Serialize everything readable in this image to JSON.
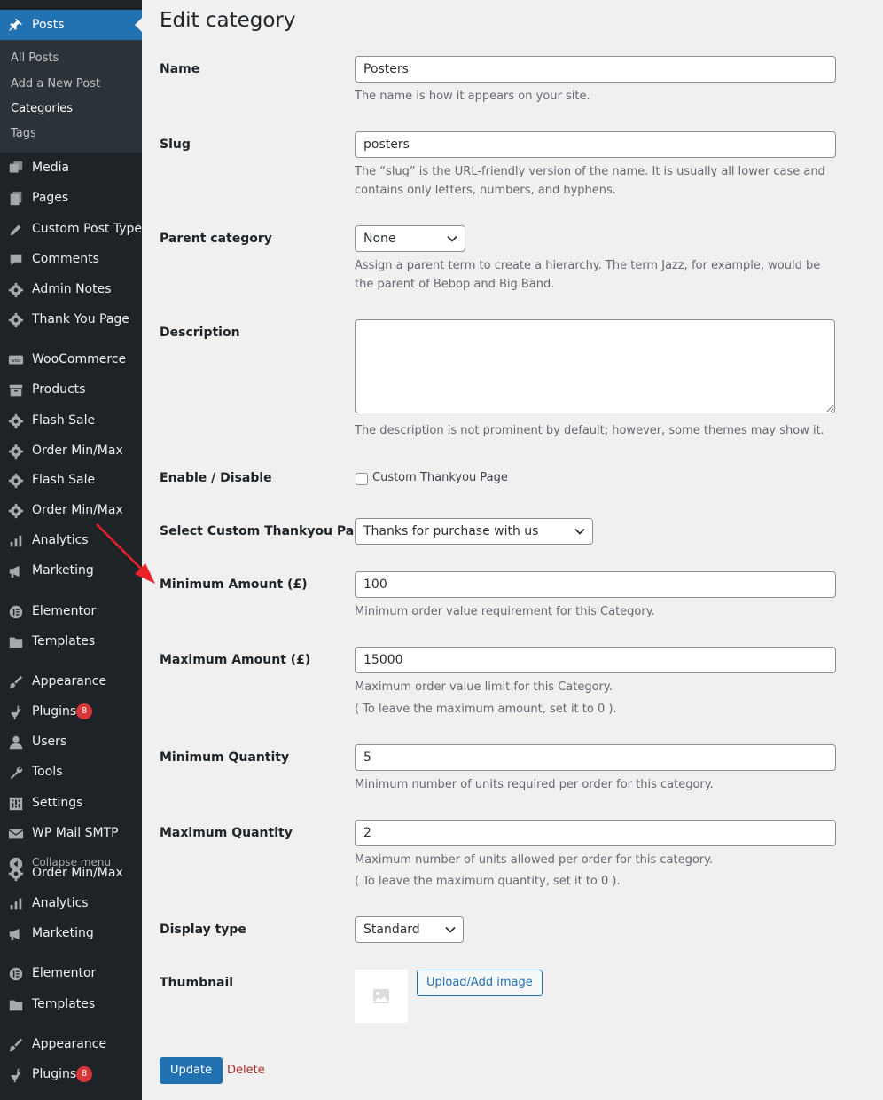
{
  "sidebar": {
    "current": {
      "label": "Posts",
      "icon": "pushpin-icon"
    },
    "submenu": [
      "All Posts",
      "Add a New Post",
      "Categories",
      "Tags"
    ],
    "items": [
      {
        "label": "Media",
        "icon": "media-icon"
      },
      {
        "label": "Pages",
        "icon": "pages-icon"
      },
      {
        "label": "Custom Post Type",
        "icon": "pencil-icon"
      },
      {
        "label": "Comments",
        "icon": "comment-icon"
      },
      {
        "label": "Admin Notes",
        "icon": "gear-icon"
      },
      {
        "label": "Thank You Page",
        "icon": "gear-icon"
      },
      {
        "label": "WooCommerce",
        "icon": "woo-icon"
      },
      {
        "label": "Products",
        "icon": "archive-icon"
      },
      {
        "label": "Flash Sale",
        "icon": "gear-icon"
      },
      {
        "label": "Order Min/Max",
        "icon": "gear-icon"
      },
      {
        "label": "Flash Sale",
        "icon": "gear-icon"
      },
      {
        "label": "Order Min/Max",
        "icon": "gear-icon"
      },
      {
        "label": "Analytics",
        "icon": "bar-chart-icon"
      },
      {
        "label": "Marketing",
        "icon": "megaphone-icon"
      },
      {
        "label": "Elementor",
        "icon": "elementor-icon"
      },
      {
        "label": "Templates",
        "icon": "folder-icon"
      },
      {
        "label": "Appearance",
        "icon": "paintbrush-icon"
      },
      {
        "label": "Plugins",
        "icon": "plug-icon",
        "badge": "8"
      },
      {
        "label": "Users",
        "icon": "user-icon"
      },
      {
        "label": "Tools",
        "icon": "wrench-icon"
      },
      {
        "label": "Settings",
        "icon": "sliders-icon"
      },
      {
        "label": "WP Mail SMTP",
        "icon": "mail-icon"
      },
      {
        "label": "Collapse menu",
        "icon": "collapse-icon"
      },
      {
        "label": "Order Min/Max",
        "icon": "gear-icon"
      },
      {
        "label": "Analytics",
        "icon": "bar-chart-icon"
      },
      {
        "label": "Marketing",
        "icon": "megaphone-icon"
      },
      {
        "label": "Elementor",
        "icon": "elementor-icon"
      },
      {
        "label": "Templates",
        "icon": "folder-icon"
      },
      {
        "label": "Appearance",
        "icon": "paintbrush-icon"
      },
      {
        "label": "Plugins",
        "icon": "plug-icon",
        "badge": "8"
      }
    ]
  },
  "page": {
    "title": "Edit category"
  },
  "form": {
    "name": {
      "label": "Name",
      "value": "Posters",
      "desc": "The name is how it appears on your site."
    },
    "slug": {
      "label": "Slug",
      "value": "posters",
      "desc": "The “slug” is the URL-friendly version of the name. It is usually all lower case and contains only letters, numbers, and hyphens."
    },
    "parent": {
      "label": "Parent category",
      "value": "None",
      "desc": "Assign a parent term to create a hierarchy. The term Jazz, for example, would be the parent of Bebop and Big Band."
    },
    "description": {
      "label": "Description",
      "desc": "The description is not prominent by default; however, some themes may show it."
    },
    "enable": {
      "label": "Enable / Disable",
      "checkbox_label": "Custom Thankyou Page"
    },
    "thankyou": {
      "label": "Select Custom Thankyou Page",
      "value": "Thanks for purchase with us"
    },
    "min_amount": {
      "label": "Minimum Amount (£)",
      "value": "100",
      "desc": "Minimum order value requirement for this Category."
    },
    "max_amount": {
      "label": "Maximum Amount (£)",
      "value": "15000",
      "desc": "Maximum order value limit for this Category.",
      "note": "( To leave the maximum amount, set it to 0 )."
    },
    "min_qty": {
      "label": "Minimum Quantity",
      "value": "5",
      "desc": "Minimum number of units required per order for this category."
    },
    "max_qty": {
      "label": "Maximum Quantity",
      "value": "2",
      "desc": "Maximum number of units allowed per order for this category.",
      "note": "( To leave the maximum quantity, set it to 0 )."
    },
    "display_type": {
      "label": "Display type",
      "value": "Standard"
    },
    "thumbnail": {
      "label": "Thumbnail",
      "upload_label": "Upload/Add image",
      "placeholder_icon": "image-placeholder-icon"
    },
    "update_label": "Update",
    "delete_label": "Delete"
  },
  "colors": {
    "accent": "#2271b1",
    "sidebar": "#1d2327",
    "danger": "#b32d2e",
    "badge": "#d63638",
    "annotation": "#e8212b"
  }
}
